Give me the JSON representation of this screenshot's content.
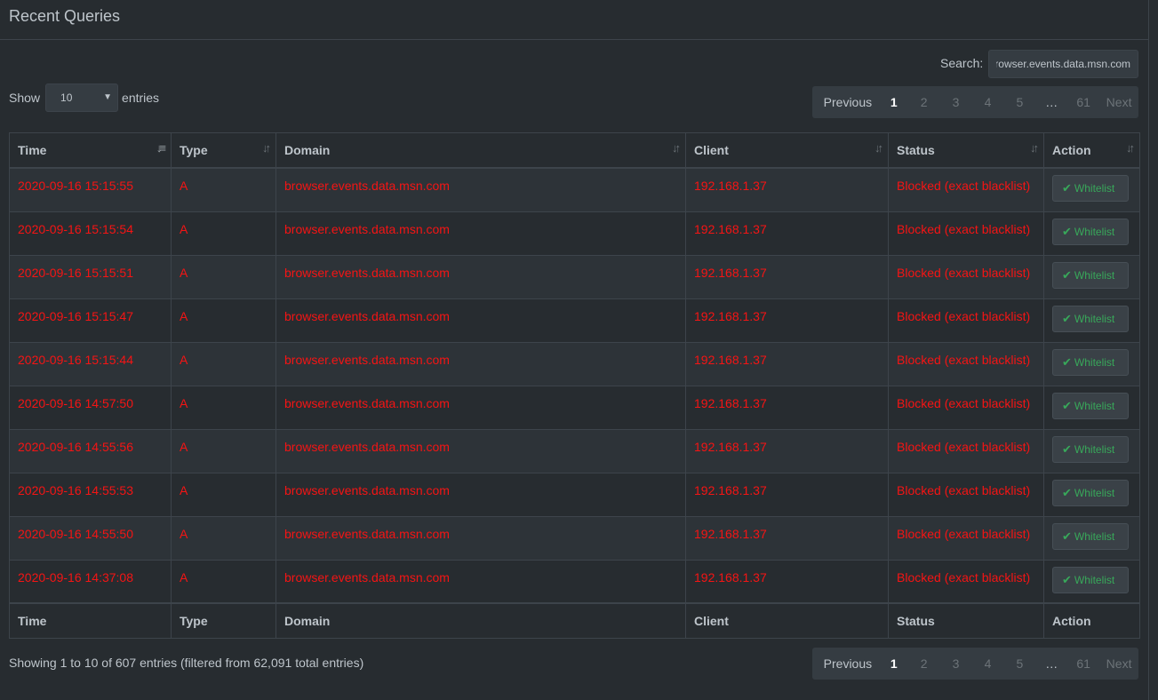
{
  "panel": {
    "title": "Recent Queries"
  },
  "controls": {
    "search_label": "Search:",
    "search_value": "browser.events.data.msn.com",
    "show_prefix": "Show",
    "show_value": "10",
    "show_suffix": "entries"
  },
  "pagination": {
    "previous": "Previous",
    "pages": [
      "1",
      "2",
      "3",
      "4",
      "5"
    ],
    "ellipsis": "…",
    "last": "61",
    "next": "Next",
    "active_page": "1"
  },
  "table": {
    "columns": [
      "Time",
      "Type",
      "Domain",
      "Client",
      "Status",
      "Action"
    ],
    "sorted_column": "Time",
    "action_label": "Whitelist",
    "rows": [
      {
        "time": "2020-09-16 15:15:55",
        "type": "A",
        "domain": "browser.events.data.msn.com",
        "client": "192.168.1.37",
        "status": "Blocked (exact blacklist)"
      },
      {
        "time": "2020-09-16 15:15:54",
        "type": "A",
        "domain": "browser.events.data.msn.com",
        "client": "192.168.1.37",
        "status": "Blocked (exact blacklist)"
      },
      {
        "time": "2020-09-16 15:15:51",
        "type": "A",
        "domain": "browser.events.data.msn.com",
        "client": "192.168.1.37",
        "status": "Blocked (exact blacklist)"
      },
      {
        "time": "2020-09-16 15:15:47",
        "type": "A",
        "domain": "browser.events.data.msn.com",
        "client": "192.168.1.37",
        "status": "Blocked (exact blacklist)"
      },
      {
        "time": "2020-09-16 15:15:44",
        "type": "A",
        "domain": "browser.events.data.msn.com",
        "client": "192.168.1.37",
        "status": "Blocked (exact blacklist)"
      },
      {
        "time": "2020-09-16 14:57:50",
        "type": "A",
        "domain": "browser.events.data.msn.com",
        "client": "192.168.1.37",
        "status": "Blocked (exact blacklist)"
      },
      {
        "time": "2020-09-16 14:55:56",
        "type": "A",
        "domain": "browser.events.data.msn.com",
        "client": "192.168.1.37",
        "status": "Blocked (exact blacklist)"
      },
      {
        "time": "2020-09-16 14:55:53",
        "type": "A",
        "domain": "browser.events.data.msn.com",
        "client": "192.168.1.37",
        "status": "Blocked (exact blacklist)"
      },
      {
        "time": "2020-09-16 14:55:50",
        "type": "A",
        "domain": "browser.events.data.msn.com",
        "client": "192.168.1.37",
        "status": "Blocked (exact blacklist)"
      },
      {
        "time": "2020-09-16 14:37:08",
        "type": "A",
        "domain": "browser.events.data.msn.com",
        "client": "192.168.1.37",
        "status": "Blocked (exact blacklist)"
      }
    ]
  },
  "footer": {
    "info": "Showing 1 to 10 of 607 entries (filtered from 62,091 total entries)"
  },
  "colors": {
    "background": "#272c30",
    "row_alt": "#2d3338",
    "blocked_text": "#f51414",
    "whitelist_green": "#38a85a",
    "muted_text": "#bec5cb"
  },
  "icons": {
    "sort_active": "sort-amount-desc-icon",
    "sort_inactive": "sort-icon",
    "action": "check-icon",
    "select": "chevron-down-icon"
  }
}
